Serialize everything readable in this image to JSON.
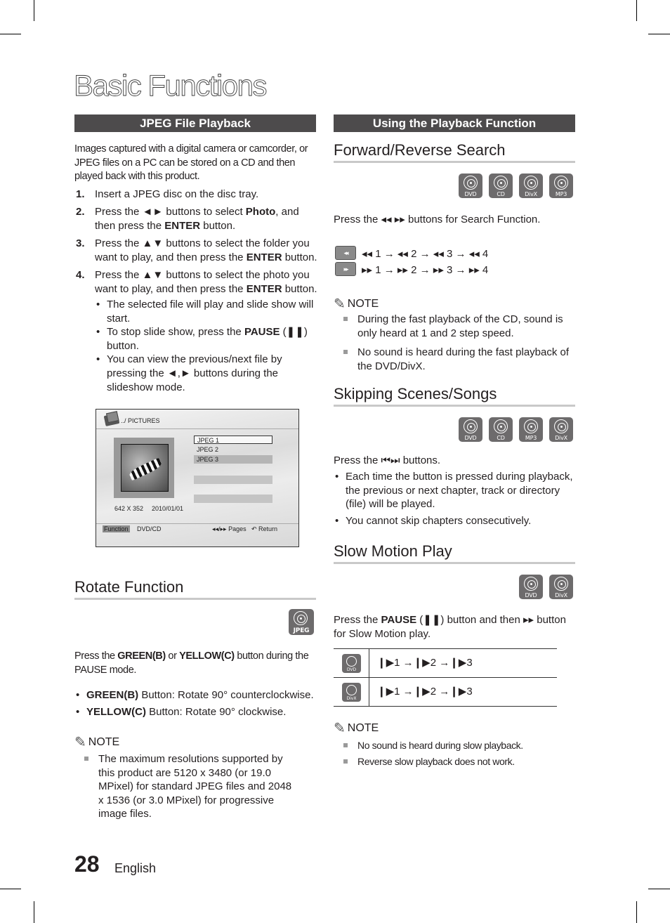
{
  "page": {
    "title": "Basic Functions",
    "page_number": "28",
    "language": "English"
  },
  "left": {
    "section_bar": "JPEG File Playback",
    "intro": "Images captured with a digital camera or camcorder, or JPEG files on a PC can be stored on a CD and then played back with this product.",
    "steps": [
      {
        "n": "1.",
        "text": "Insert a JPEG disc on the disc tray."
      },
      {
        "n": "2.",
        "pre": "Press the ◄► buttons to select ",
        "b1": "Photo",
        "mid": ", and then press the ",
        "b2": "ENTER",
        "post": " button."
      },
      {
        "n": "3.",
        "pre": "Press the ▲▼ buttons to select the folder you want to play, and then press the ",
        "b2": "ENTER",
        "post": " button."
      },
      {
        "n": "4.",
        "pre": "Press the ▲▼ buttons to select the photo you want to play, and then press the ",
        "b2": "ENTER",
        "post": " button."
      }
    ],
    "step4_bullets": [
      {
        "text": "The selected file will play and slide show will start."
      },
      {
        "pre": "To stop slide show, press the ",
        "b": "PAUSE",
        "post": " (❚❚) button."
      },
      {
        "text": "You can view the previous/next file by pressing the ◄,► buttons during the slideshow mode."
      }
    ],
    "screen": {
      "path": "../ PICTURES",
      "files": [
        "JPEG 1",
        "JPEG 2",
        "JPEG 3"
      ],
      "resolution": "642 X 352",
      "date": "2010/01/01",
      "function_label": "Function",
      "function_value": "DVD/CD",
      "pages_label": "◂◂/▸▸ Pages",
      "return_label": "↶ Return"
    },
    "rotate": {
      "heading": "Rotate Function",
      "disc_label": "JPEG",
      "intro_pre": "Press the ",
      "intro_b1": "GREEN(B)",
      "intro_mid": " or ",
      "intro_b2": "YELLOW(C)",
      "intro_post": " button during the PAUSE mode.",
      "bullets": [
        {
          "b": "GREEN(B)",
          "text": " Button: Rotate 90° counterclockwise."
        },
        {
          "b": "YELLOW(C)",
          "text": " Button: Rotate 90° clockwise."
        }
      ],
      "note_title": "NOTE",
      "notes": [
        "The maximum resolutions supported by this product are 5120 x 3480 (or 19.0 MPixel) for standard JPEG files and 2048 x 1536 (or 3.0 MPixel) for progressive image files."
      ]
    }
  },
  "right": {
    "section_bar": "Using the Playback Function",
    "search": {
      "heading": "Forward/Reverse Search",
      "discs": [
        "DVD",
        "CD",
        "DivX",
        "MP3"
      ],
      "text": "Press the ◂◂ ▸▸ buttons for Search Function.",
      "rev_button": "◂◂",
      "fwd_button": "▸▸",
      "rev_seq": "◂◂ 1 → ◂◂ 2 → ◂◂ 3 → ◂◂ 4",
      "fwd_seq": "▸▸ 1 → ▸▸ 2 → ▸▸ 3 → ▸▸ 4",
      "note_title": "NOTE",
      "notes": [
        "During the fast playback of the CD, sound is only heard at 1 and 2 step speed.",
        "No sound is heard during the fast playback of the DVD/DivX."
      ]
    },
    "skip": {
      "heading": "Skipping Scenes/Songs",
      "discs": [
        "DVD",
        "CD",
        "MP3",
        "DivX"
      ],
      "text": "Press the ⏮⏭ buttons.",
      "bullets": [
        "Each time the button is pressed during playback, the previous or next chapter, track or directory (file) will be played.",
        "You cannot skip chapters consecutively."
      ]
    },
    "slow": {
      "heading": "Slow Motion Play",
      "discs": [
        "DVD",
        "DivX"
      ],
      "text_pre": "Press the ",
      "text_b": "PAUSE",
      "text_post": " (❚❚) button and then ▸▸ button for Slow Motion play.",
      "table": [
        {
          "disc": "DVD",
          "seq": "❙▶1 →❙▶2 →❙▶3"
        },
        {
          "disc": "DivX",
          "seq": "❙▶1 →❙▶2 →❙▶3"
        }
      ],
      "note_title": "NOTE",
      "notes": [
        "No sound is heard during slow playback.",
        "Reverse slow playback does not work."
      ]
    }
  }
}
